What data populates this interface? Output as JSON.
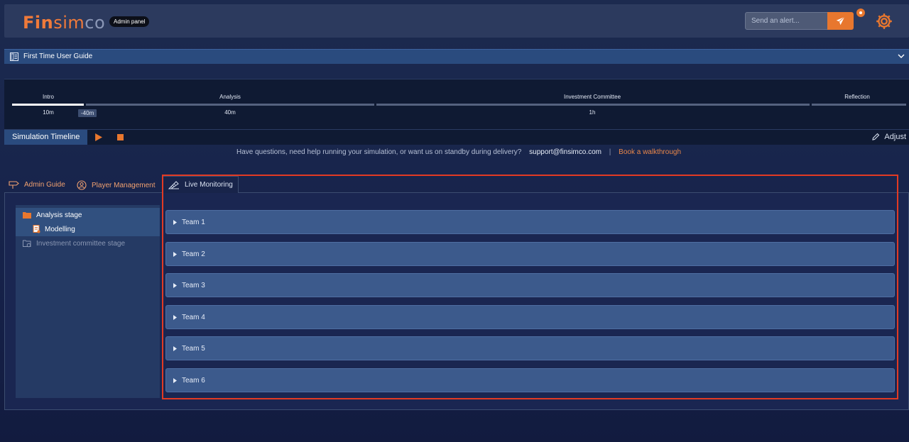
{
  "header": {
    "logo_fin": "Fin",
    "logo_sim": "sim",
    "logo_co": "co",
    "badge": "Admin panel",
    "alert_placeholder": "Send an alert..."
  },
  "guide": {
    "title": "First Time User Guide"
  },
  "timeline": {
    "stages": [
      {
        "label": "Intro",
        "duration": "10m"
      },
      {
        "label": "Analysis",
        "duration": "40m"
      },
      {
        "label": "Investment Committee",
        "duration": "1h"
      },
      {
        "label": "Reflection",
        "duration": ""
      }
    ],
    "marker": "-40m",
    "label": "Simulation Timeline",
    "adjust": "Adjust"
  },
  "help": {
    "text": "Have questions, need help running your simulation, or want us on standby during delivery?",
    "email": "support@finsimco.com",
    "separator": "|",
    "book": "Book a walkthrough"
  },
  "tabs": [
    {
      "label": "Admin Guide",
      "icon": "signpost-icon"
    },
    {
      "label": "Player Management",
      "icon": "user-gear-icon"
    },
    {
      "label": "Live Monitoring",
      "icon": "pencil-ruler-icon",
      "active": true
    }
  ],
  "tree": {
    "items": [
      {
        "label": "Analysis stage",
        "icon": "folder-open-icon"
      },
      {
        "label": "Modelling",
        "icon": "document-icon"
      },
      {
        "label": "Investment committee stage",
        "icon": "folder-clock-icon"
      }
    ]
  },
  "teams": [
    "Team 1",
    "Team 2",
    "Team 3",
    "Team 4",
    "Team 5",
    "Team 6"
  ],
  "colors": {
    "accent": "#e8772e",
    "highlight": "#e23a23"
  }
}
